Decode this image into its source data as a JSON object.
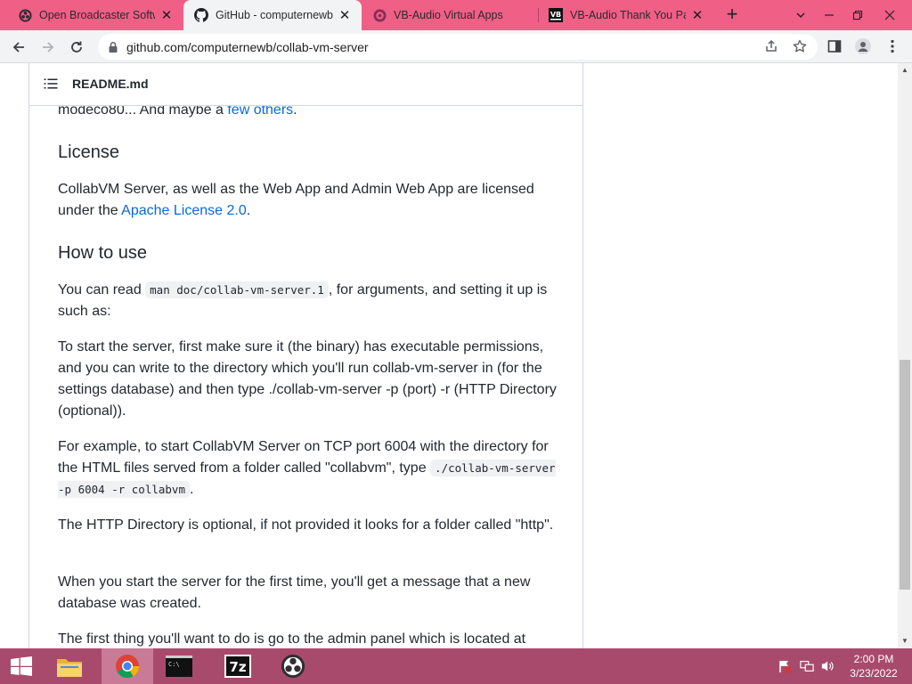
{
  "browser": {
    "tabs": [
      {
        "title": "Open Broadcaster Software",
        "icon": "obs-icon",
        "active": false
      },
      {
        "title": "GitHub - computernewb/",
        "icon": "github-icon",
        "active": true
      },
      {
        "title": "VB-Audio Virtual Apps",
        "icon": "vb-audio-icon",
        "active": false
      },
      {
        "title": "VB-Audio Thank You Page",
        "icon": "vb-logo-icon",
        "active": false
      }
    ],
    "new_tab_label": "+",
    "url": "github.com/computernewb/collab-vm-server"
  },
  "readme": {
    "filename": "README.md",
    "intro_text": "modeco80... And maybe a ",
    "intro_link": "few others",
    "intro_end": ".",
    "license_heading": "License",
    "license_text": "CollabVM Server, as well as the Web App and Admin Web App are licensed under the ",
    "license_link": "Apache License 2.0",
    "license_end": ".",
    "howto_heading": "How to use",
    "p1_a": "You can read ",
    "p1_code": "man doc/collab-vm-server.1",
    "p1_b": ", for arguments, and setting it up is such as:",
    "p2": "To start the server, first make sure it (the binary) has executable permissions, and you can write to the directory which you'll run collab-vm-server in (for the settings database) and then type ./collab-vm-server -p (port) -r (HTTP Directory (optional)).",
    "p3_a": "For example, to start CollabVM Server on TCP port 6004 with the directory for the HTML files served from a folder called \"collabvm\", type ",
    "p3_code": "./collab-vm-server -p 6004 -r collabvm",
    "p3_b": ".",
    "p4": "The HTTP Directory is optional, if not provided it looks for a folder called \"http\".",
    "p5": "When you start the server for the first time, you'll get a message that a new database was created.",
    "p6": "The first thing you'll want to do is go to the admin panel which is located at"
  },
  "taskbar": {
    "apps": [
      "file-explorer-icon",
      "chrome-icon",
      "command-prompt-icon",
      "7zip-icon",
      "obs-icon"
    ],
    "cmd_label": "C:\\",
    "sevenzip_label": "7z",
    "time": "2:00 PM",
    "date": "3/23/2022"
  },
  "colors": {
    "tabstrip": "#f05f86",
    "link": "#0969da",
    "taskbar": "#a84a6c"
  }
}
